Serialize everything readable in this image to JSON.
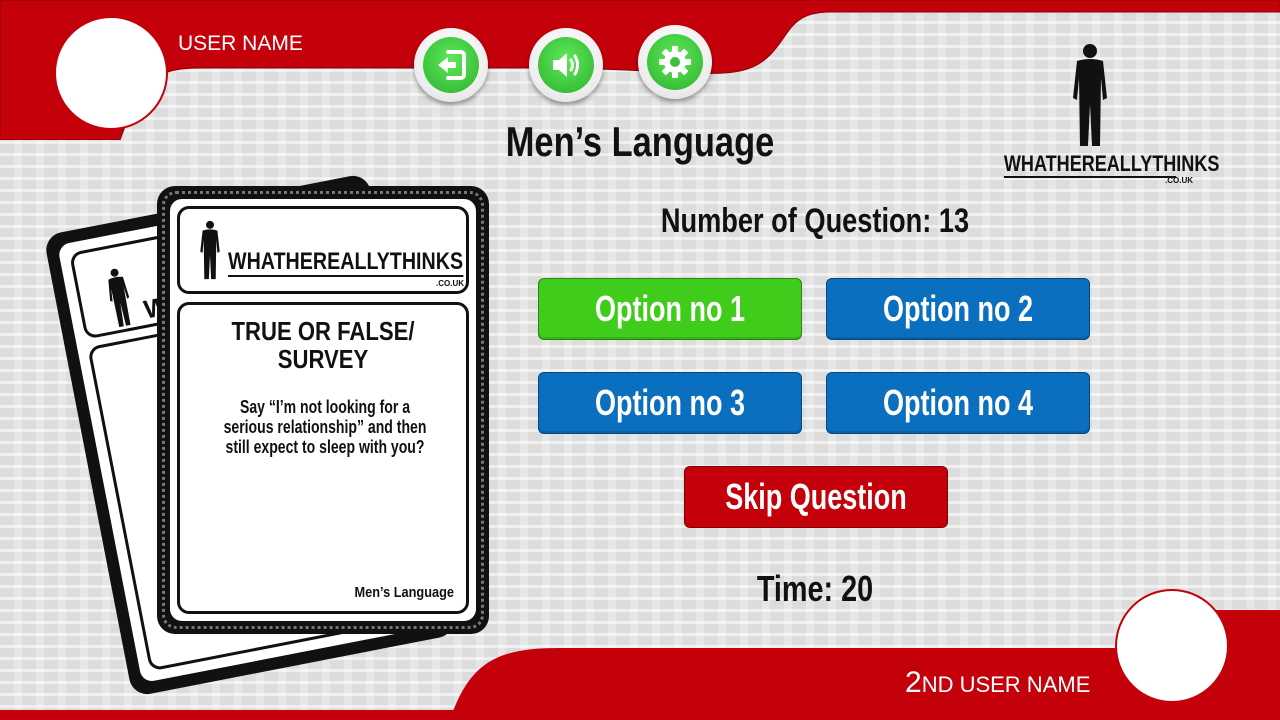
{
  "players": {
    "player1_name": "USER NAME",
    "player2_prefix": "2",
    "player2_suffix": "ND USER NAME"
  },
  "toolbar": {
    "exit_icon": "exit-icon",
    "sound_icon": "sound-icon",
    "settings_icon": "gear-icon"
  },
  "title": "Men’s Language",
  "brand": {
    "name": "WHATHEREALLYTHINKS",
    "domain": ".CO.UK"
  },
  "quiz": {
    "question_count_label": "Number of Question: 13",
    "options": [
      "Option no 1",
      "Option no 2",
      "Option no 3",
      "Option no 4"
    ],
    "selected_option": 1,
    "skip_label": "Skip Question",
    "time_label": "Time: 20"
  },
  "card": {
    "brand_name": "WHATHEREALLYTHINKS",
    "brand_domain": ".CO.UK",
    "back_brand_fragment": "WH",
    "type": "TRUE OR FALSE/ SURVEY",
    "text": "Say “I’m not looking for a serious relationship” and then still expect to sleep with you?",
    "category": "Men’s Language"
  },
  "colors": {
    "red": "#c4000a",
    "green": "#3fcc1a",
    "blue": "#0a6fbf"
  }
}
